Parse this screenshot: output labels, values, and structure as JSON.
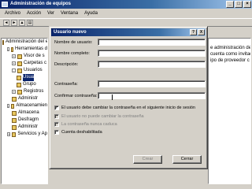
{
  "mmc": {
    "title": "Administración de equipos",
    "menu": [
      "Archivo",
      "Acción",
      "Ver",
      "Ventana",
      "Ayuda"
    ],
    "tree": [
      {
        "label": "Administración del e",
        "exp": "",
        "indent": 0
      },
      {
        "label": "Herramientas d",
        "exp": "-",
        "indent": 1
      },
      {
        "label": "Visor de s",
        "exp": "+",
        "indent": 2
      },
      {
        "label": "Carpetas c",
        "exp": "+",
        "indent": 2
      },
      {
        "label": "Usuarios",
        "exp": "-",
        "indent": 2
      },
      {
        "label": "Usua",
        "exp": "",
        "indent": 3,
        "selected": true
      },
      {
        "label": "Grupo",
        "exp": "",
        "indent": 3
      },
      {
        "label": "Registros",
        "exp": "+",
        "indent": 2
      },
      {
        "label": "Administr",
        "exp": "",
        "indent": 2
      },
      {
        "label": "Almacenamien",
        "exp": "-",
        "indent": 1
      },
      {
        "label": "Almacena",
        "exp": "",
        "indent": 2
      },
      {
        "label": "Desfragm",
        "exp": "",
        "indent": 2
      },
      {
        "label": "Administr",
        "exp": "",
        "indent": 2
      },
      {
        "label": "Servicios y Ap",
        "exp": "+",
        "indent": 1
      }
    ],
    "right_pane": [
      "e administración del e",
      "cuenta como invitado",
      "ipo de proveedor c"
    ]
  },
  "dialog": {
    "title": "Usuario nuevo",
    "help_label": "?",
    "close_label": "X",
    "labels": {
      "username": "Nombre de usuario:",
      "fullname": "Nombre completo:",
      "description": "Descripción:",
      "password": "Contraseña:",
      "confirm": "Confirmar contraseña:"
    },
    "values": {
      "username": "",
      "fullname": "",
      "description": "",
      "password": "",
      "confirm": ""
    },
    "options": [
      {
        "label": "El usuario debe cambiar la contraseña en el siguiente inicio de sesión",
        "checked": true,
        "disabled": false
      },
      {
        "label": "El usuario no puede cambiar la contraseña",
        "checked": false,
        "disabled": true
      },
      {
        "label": "La contraseña nunca caduca",
        "checked": false,
        "disabled": true
      },
      {
        "label": "Cuenta deshabilitada",
        "checked": false,
        "disabled": false
      }
    ],
    "buttons": {
      "create": "Crear",
      "close": "Cerrar"
    }
  }
}
